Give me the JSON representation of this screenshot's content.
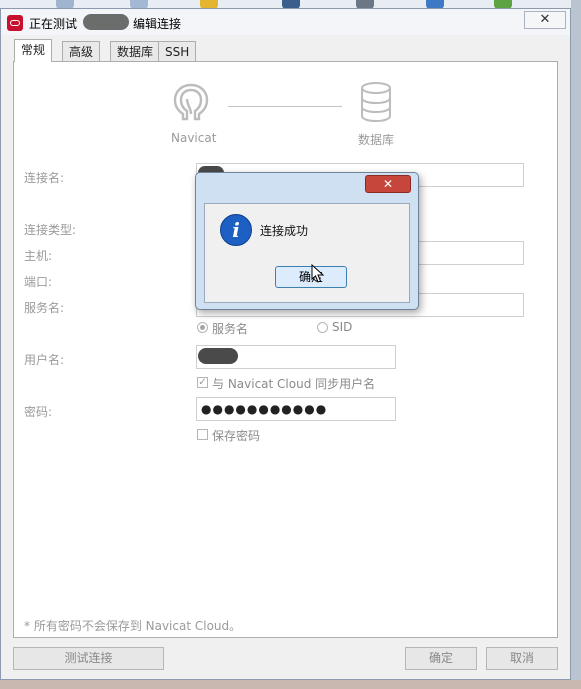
{
  "window": {
    "title_prefix": "正在测试",
    "title_suffix": "编辑连接",
    "close_glyph": "✕"
  },
  "tabs": [
    {
      "label": "常规",
      "active": true
    },
    {
      "label": "高级",
      "active": false
    },
    {
      "label": "数据库",
      "active": false
    },
    {
      "label": "SSH",
      "active": false
    }
  ],
  "diagram": {
    "left_caption": "Navicat",
    "right_caption": "数据库"
  },
  "form": {
    "connection_name_label": "连接名:",
    "connection_type_label": "连接类型:",
    "host_label": "主机:",
    "port_label": "端口:",
    "service_name_label": "服务名:",
    "service_option": "服务名",
    "sid_option": "SID",
    "username_label": "用户名:",
    "sync_checkbox_label": "与 Navicat Cloud 同步用户名",
    "password_label": "密码:",
    "password_value": "●●●●●●●●●●●",
    "save_password_label": "保存密码"
  },
  "footnote": "* 所有密码不会保存到 Navicat Cloud。",
  "buttons": {
    "test": "测试连接",
    "ok": "确定",
    "cancel": "取消"
  },
  "message_box": {
    "close_glyph": "✕",
    "text": "连接成功",
    "ok_label": "确定",
    "icon_glyph": "i"
  },
  "colors": {
    "accent_red": "#c8102e",
    "info_blue": "#1d5fc2"
  }
}
